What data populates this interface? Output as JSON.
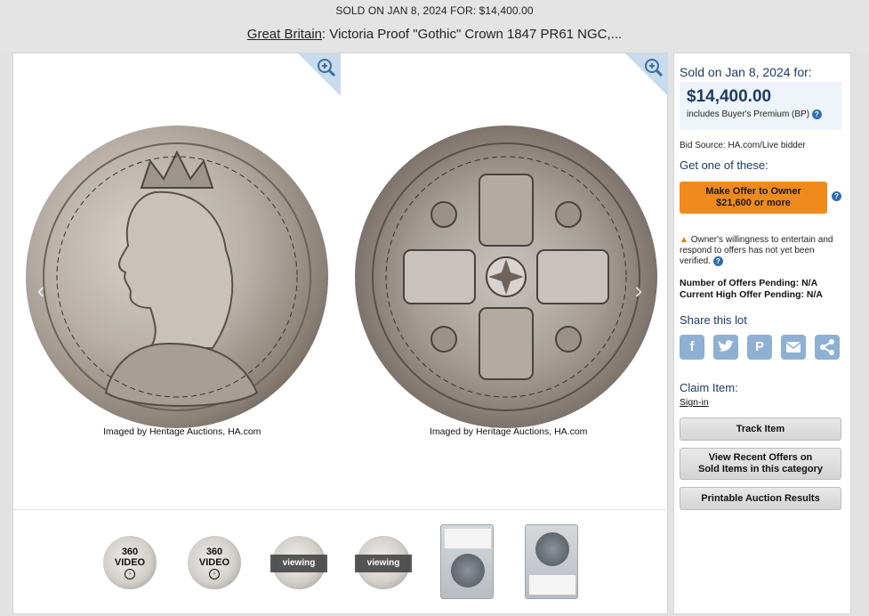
{
  "header": {
    "sold_line": "SOLD ON JAN 8, 2024 FOR: $14,400.00",
    "category_link": "Great Britain",
    "title_rest": ": Victoria Proof \"Gothic\" Crown 1847 PR61 NGC,..."
  },
  "images": {
    "obverse_caption": "Imaged by Heritage Auctions, HA.com",
    "reverse_caption": "Imaged by Heritage Auctions, HA.com",
    "zoom_icon": "zoom-in-icon",
    "prev_icon": "chevron-left-icon",
    "next_icon": "chevron-right-icon"
  },
  "thumbnails": [
    {
      "type": "360",
      "line1": "360",
      "line2": "VIDEO",
      "icon": "play-icon"
    },
    {
      "type": "360",
      "line1": "360",
      "line2": "VIDEO",
      "icon": "play-icon"
    },
    {
      "type": "viewing",
      "label": "viewing"
    },
    {
      "type": "viewing",
      "label": "viewing"
    },
    {
      "type": "slab-front"
    },
    {
      "type": "slab-back"
    }
  ],
  "sidebar": {
    "sold_heading": "Sold on Jan 8, 2024 for:",
    "price": "$14,400.00",
    "price_note": "includes Buyer's Premium (BP)",
    "bid_source": "Bid Source: HA.com/Live bidder",
    "get_one": "Get one of these:",
    "offer_button_line1": "Make Offer to Owner",
    "offer_button_line2": "$21,600 or more",
    "warning": "Owner's willingness to entertain and respond to offers has not yet been verified.",
    "pending_offers": "Number of Offers Pending: N/A",
    "high_offer": "Current High Offer Pending: N/A",
    "share_title": "Share this lot",
    "share_icons": [
      "facebook-icon",
      "twitter-icon",
      "pinterest-icon",
      "email-icon",
      "share-icon"
    ],
    "claim_title": "Claim Item:",
    "sign_in": "Sign-in",
    "track_button": "Track Item",
    "recent_offers_line1": "View Recent Offers on",
    "recent_offers_line2": "Sold Items in this category",
    "print_button": "Printable Auction Results"
  },
  "colors": {
    "accent_navy": "#1f3b63",
    "offer_orange": "#f08a1c",
    "share_blue": "#8eb0d2",
    "price_box_bg": "#eef4fa"
  }
}
